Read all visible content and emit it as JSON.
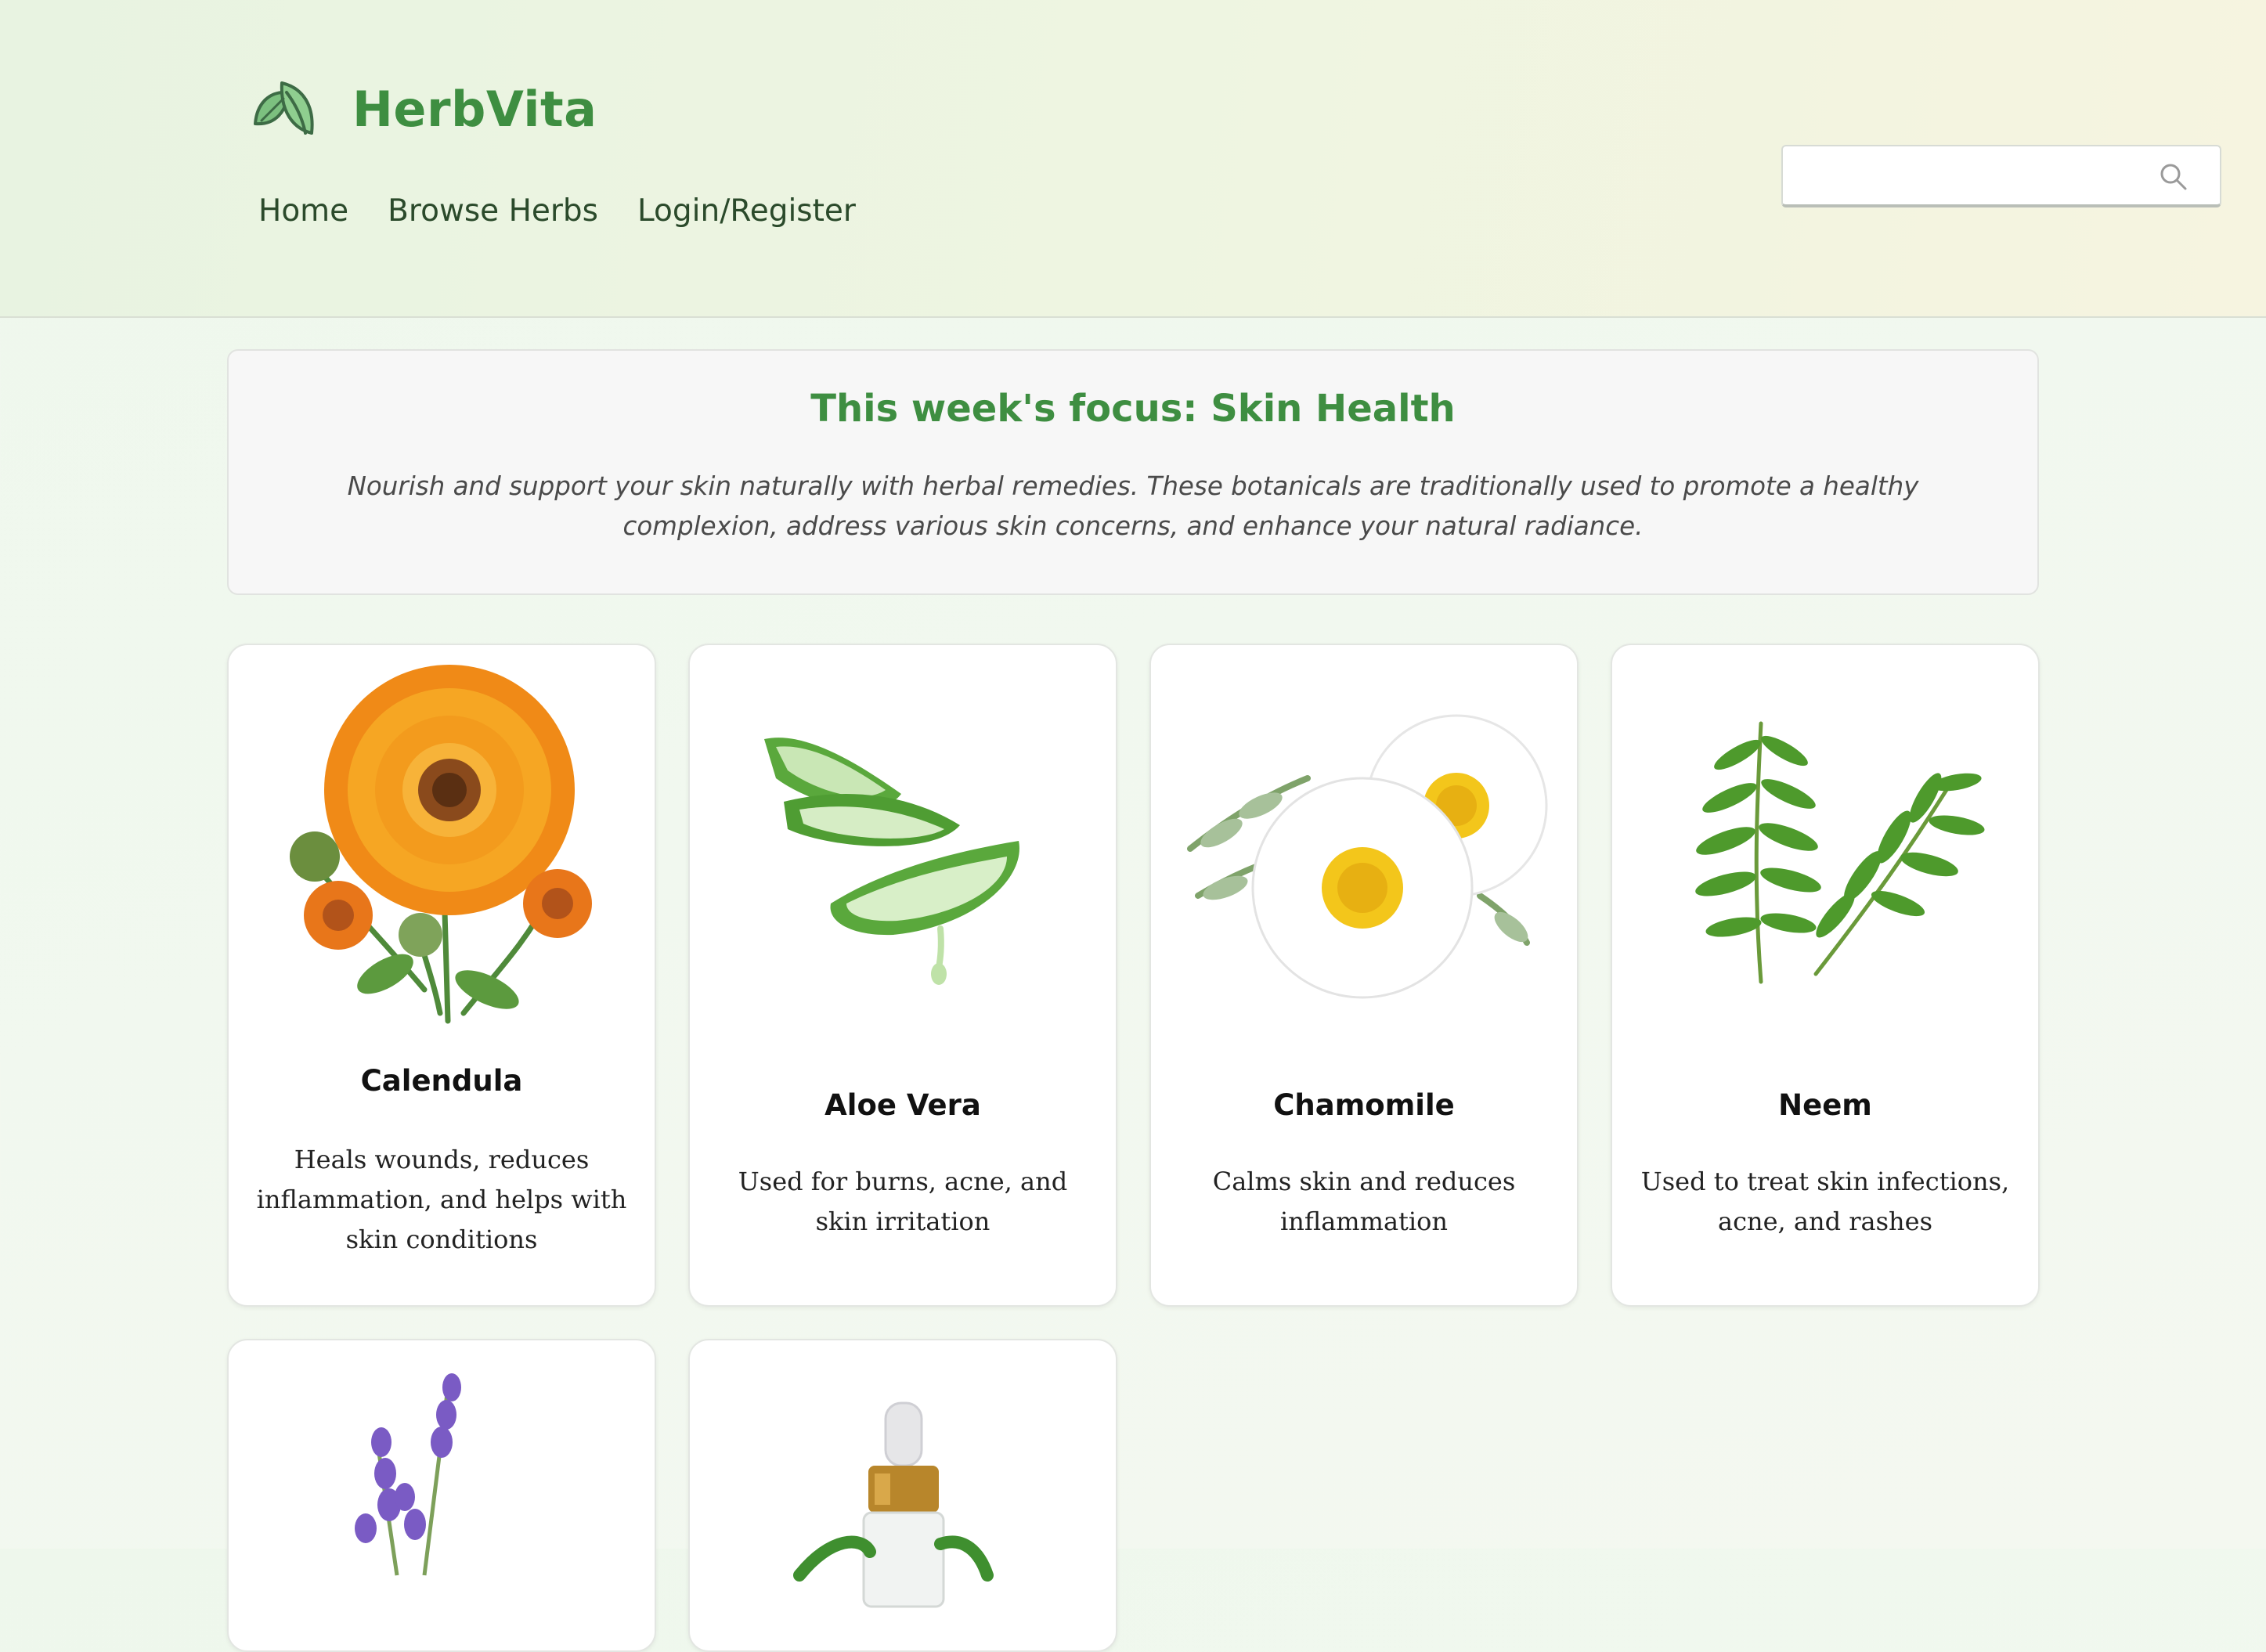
{
  "brand": {
    "name": "HerbVita",
    "logo_icon": "leaf-icon",
    "accent": "#3e8e41"
  },
  "nav": {
    "items": [
      "Home",
      "Browse Herbs",
      "Login/Register"
    ]
  },
  "search": {
    "value": "",
    "placeholder": "",
    "icon": "search-icon"
  },
  "focus": {
    "title": "This week's focus: Skin Health",
    "description": "Nourish and support your skin naturally with herbal remedies. These botanicals are traditionally used to promote a healthy complexion, address various skin concerns, and enhance your natural radiance."
  },
  "herbs": [
    {
      "name": "Calendula",
      "description": "Heals wounds, reduces inflammation, and helps with skin conditions",
      "image": "calendula-flower"
    },
    {
      "name": "Aloe Vera",
      "description": "Used for burns, acne, and skin irritation",
      "image": "aloe-vera-leaves"
    },
    {
      "name": "Chamomile",
      "description": "Calms skin and reduces inflammation",
      "image": "chamomile-flowers"
    },
    {
      "name": "Neem",
      "description": "Used to treat skin infections, acne, and rashes",
      "image": "neem-leaves"
    },
    {
      "name": "",
      "description": "",
      "image": "lavender-sprigs"
    },
    {
      "name": "",
      "description": "",
      "image": "oil-dropper-bottle"
    }
  ]
}
